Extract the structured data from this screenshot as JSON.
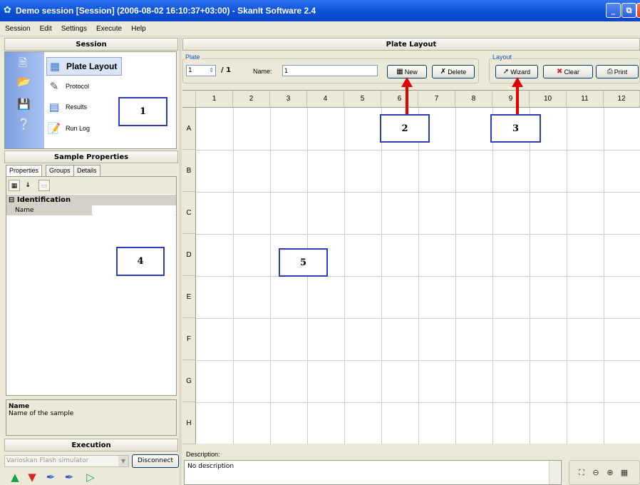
{
  "window": {
    "title": "Demo session [Session] (2006-08-02 16:10:37+03:00) - SkanIt Software 2.4",
    "controls": [
      "_",
      "⧉",
      "X"
    ]
  },
  "menu": [
    "Session",
    "Edit",
    "Settings",
    "Execute",
    "Help"
  ],
  "session": {
    "header": "Session",
    "side_icons": [
      "new-file-icon",
      "open-folder-icon",
      "save-icon",
      "help-icon"
    ],
    "nav_items": [
      {
        "label": "Plate Layout",
        "icon": "plate-layout-icon",
        "selected": true
      },
      {
        "label": "Protocol",
        "icon": "protocol-icon",
        "selected": false
      },
      {
        "label": "Results",
        "icon": "results-icon",
        "selected": false
      },
      {
        "label": "Run Log",
        "icon": "run-log-icon",
        "selected": false
      }
    ]
  },
  "sample_properties": {
    "header": "Sample Properties",
    "tabs": [
      "Properties",
      "Groups",
      "Details"
    ],
    "category": "Identification",
    "rows": [
      {
        "name": "Name",
        "value": ""
      }
    ],
    "description_title": "Name",
    "description_text": "Name of the sample"
  },
  "execution": {
    "header": "Execution",
    "instrument": "Varioskan Flash simulator",
    "disconnect_label": "Disconnect"
  },
  "plate_layout": {
    "header": "Plate Layout",
    "plate_group_label": "Plate",
    "plate_number": "1",
    "plate_total": "/ 1",
    "name_label": "Name:",
    "name_value": "1",
    "new_label": "New",
    "delete_label": "Delete",
    "layout_group_label": "Layout",
    "wizard_label": "Wizard",
    "clear_label": "Clear",
    "print_label": "Print",
    "columns": [
      "1",
      "2",
      "3",
      "4",
      "5",
      "6",
      "7",
      "8",
      "9",
      "10",
      "11",
      "12"
    ],
    "rows": [
      "A",
      "B",
      "C",
      "D",
      "E",
      "F",
      "G",
      "H"
    ],
    "description_label": "Description:",
    "description_value": "No description"
  },
  "callouts": [
    "1",
    "2",
    "3",
    "4",
    "5"
  ],
  "colors": {
    "titlebar": "#0a4fd8",
    "callout_border": "#2b3cc0",
    "arrow": "#e00000",
    "panel_bg": "#ece9d8"
  }
}
